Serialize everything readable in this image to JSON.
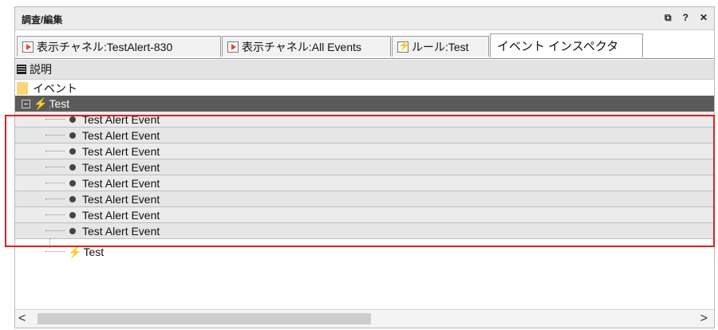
{
  "panel": {
    "title": "調査/編集",
    "controls": [
      "⧉",
      "?",
      "✕"
    ]
  },
  "tabs": [
    {
      "label": "表示チャネル:TestAlert-830",
      "icon": "play-icon"
    },
    {
      "label": "表示チャネル:All Events",
      "icon": "play-icon"
    },
    {
      "label": "ルール:Test",
      "icon": "lightning-icon"
    },
    {
      "label": "イベント インスペクタ",
      "icon": null,
      "active": true
    }
  ],
  "column_header": "説明",
  "tree": {
    "root_label": "イベント",
    "group_label": "Test",
    "events": [
      "Test Alert Event",
      "Test Alert Event",
      "Test Alert Event",
      "Test Alert Event",
      "Test Alert Event",
      "Test Alert Event",
      "Test Alert Event",
      "Test Alert Event"
    ],
    "trailing_label": "Test"
  },
  "scrollbar": {
    "left_arrow": "<",
    "right_arrow": ">"
  },
  "colors": {
    "selected_row": "#5a5a5a",
    "highlight_border": "#e02020",
    "alert_icon": "#e02020"
  }
}
